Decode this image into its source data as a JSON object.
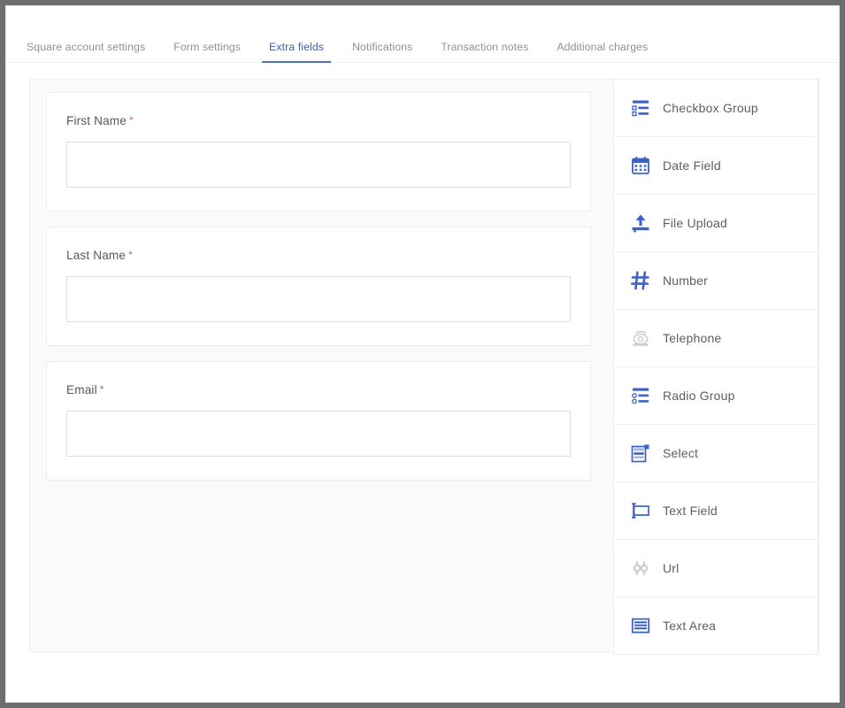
{
  "tabs": [
    {
      "label": "Square account settings",
      "active": false
    },
    {
      "label": "Form settings",
      "active": false
    },
    {
      "label": "Extra fields",
      "active": true
    },
    {
      "label": "Notifications",
      "active": false
    },
    {
      "label": "Transaction notes",
      "active": false
    },
    {
      "label": "Additional charges",
      "active": false
    }
  ],
  "form_fields": [
    {
      "label": "First Name",
      "required_marker": "*",
      "value": "",
      "placeholder": ""
    },
    {
      "label": "Last Name",
      "required_marker": "*",
      "value": "",
      "placeholder": ""
    },
    {
      "label": "Email",
      "required_marker": "*",
      "value": "",
      "placeholder": ""
    }
  ],
  "palette": {
    "items": [
      {
        "label": "Checkbox Group",
        "icon": "checkbox-group-icon",
        "muted": false
      },
      {
        "label": "Date Field",
        "icon": "calendar-icon",
        "muted": false
      },
      {
        "label": "File Upload",
        "icon": "upload-icon",
        "muted": false
      },
      {
        "label": "Number",
        "icon": "hash-icon",
        "muted": false
      },
      {
        "label": "Telephone",
        "icon": "telephone-icon",
        "muted": true
      },
      {
        "label": "Radio Group",
        "icon": "radio-group-icon",
        "muted": false
      },
      {
        "label": "Select",
        "icon": "select-icon",
        "muted": false
      },
      {
        "label": "Text Field",
        "icon": "text-field-icon",
        "muted": false
      },
      {
        "label": "Url",
        "icon": "link-icon",
        "muted": true
      },
      {
        "label": "Text Area",
        "icon": "text-area-icon",
        "muted": false
      }
    ]
  },
  "colors": {
    "accent": "#4a6fc4",
    "icon_blue": "#3e63c8",
    "icon_muted": "#c9cdd6",
    "required_red": "#c0666f",
    "tab_inactive": "#8c9196",
    "canvas_bg": "#fafafa"
  }
}
